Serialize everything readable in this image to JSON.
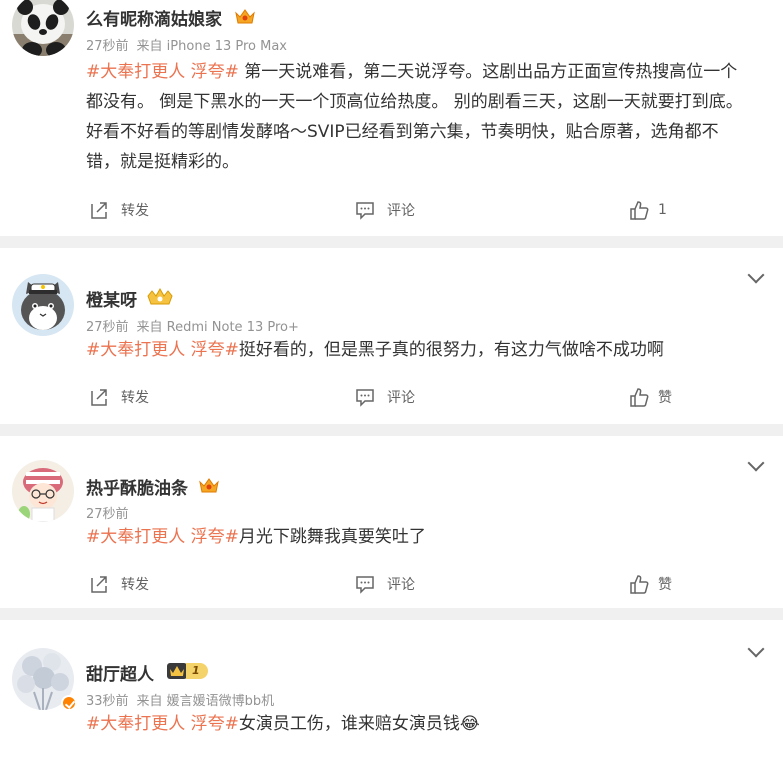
{
  "posts": [
    {
      "username": "么有昵称滴姑娘家",
      "time": "27秒前",
      "source": "来自 iPhone 13 Pro Max",
      "topic": "#大奉打更人 浮夸#",
      "lines": [
        " 第一天说难看，第二天说浮夸。这剧出品方正面宣传热搜高位一个",
        "都没有。 倒是下黑水的一天一个顶高位给热度。 别的剧看三天，这剧一天就要打到底。",
        "好看不好看的等剧情发酵咯～SVIP已经看到第六集，节奏明快，贴合原著，选角都不",
        "错，就是挺精彩的。"
      ],
      "repost_label": "转发",
      "comment_label": "评论",
      "like_label": "1",
      "avatar_icon": "panda-avatar"
    },
    {
      "username": "橙某呀",
      "time": "27秒前",
      "source": "来自 Redmi Note 13 Pro+",
      "topic": "#大奉打更人 浮夸#",
      "lines": [
        "挺好看的，但是黑子真的很努力，有这力气做啥不成功啊"
      ],
      "repost_label": "转发",
      "comment_label": "评论",
      "like_label": "赞",
      "avatar_icon": "cat-with-cap-avatar"
    },
    {
      "username": "热乎酥脆油条",
      "time": "27秒前",
      "source": "",
      "topic": "#大奉打更人 浮夸#",
      "lines": [
        "月光下跳舞我真要笑吐了"
      ],
      "repost_label": "转发",
      "comment_label": "评论",
      "like_label": "赞",
      "avatar_icon": "cartoon-girl-avatar"
    },
    {
      "username": "甜厅超人",
      "time": "33秒前",
      "source": "来自 媛言媛语微博bb机",
      "topic": "#大奉打更人 浮夸#",
      "lines": [
        "女演员工伤，谁来赔女演员钱😂"
      ],
      "avatar_icon": "flowers-avatar",
      "verified": true,
      "vip_level": "1"
    }
  ],
  "colors": {
    "topic": "#eb7350",
    "meta": "#939393",
    "background": "#f0f0f0",
    "verify_badge": "#ff8200"
  }
}
